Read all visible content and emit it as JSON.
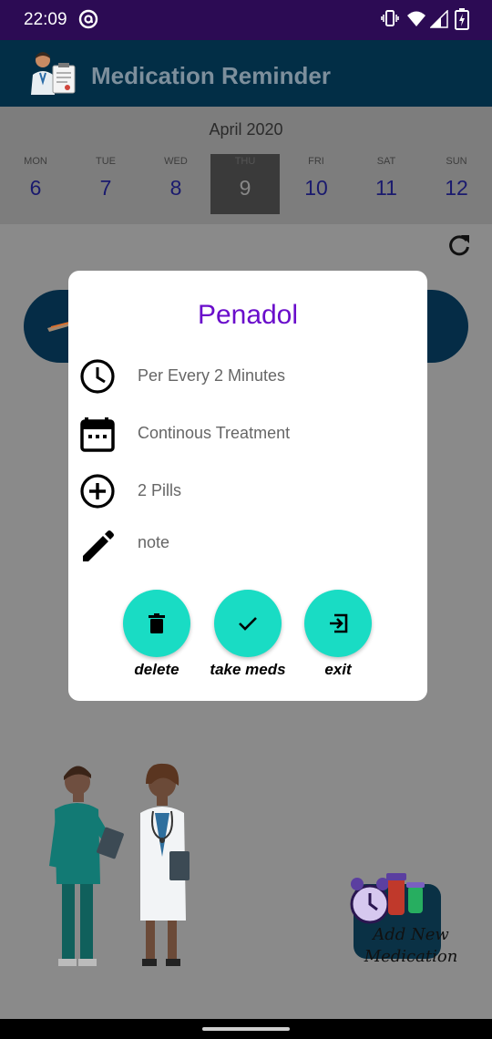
{
  "status": {
    "time": "22:09"
  },
  "app": {
    "title": "Medication Reminder"
  },
  "calendar": {
    "month": "April 2020",
    "days": [
      {
        "name": "MON",
        "num": "6"
      },
      {
        "name": "TUE",
        "num": "7"
      },
      {
        "name": "WED",
        "num": "8"
      },
      {
        "name": "THU",
        "num": "9"
      },
      {
        "name": "FRI",
        "num": "10"
      },
      {
        "name": "SAT",
        "num": "11"
      },
      {
        "name": "SUN",
        "num": "12"
      }
    ],
    "selected": "THU"
  },
  "dialog": {
    "title": "Penadol",
    "rows": [
      {
        "icon": "clock-icon",
        "text": "Per Every 2 Minutes"
      },
      {
        "icon": "calendar-icon",
        "text": "Continous Treatment"
      },
      {
        "icon": "plus-circle-icon",
        "text": "2 Pills"
      },
      {
        "icon": "pencil-icon",
        "text": "note"
      }
    ],
    "actions": [
      {
        "icon": "trash-icon",
        "label": "delete"
      },
      {
        "icon": "check-icon",
        "label": "take meds"
      },
      {
        "icon": "exit-icon",
        "label": "exit"
      }
    ]
  },
  "add_new": {
    "label": "Add New Medication"
  },
  "colors": {
    "accent": "#19dcc4",
    "title": "#6a0dcb",
    "appbar": "#022e46",
    "statusbar": "#2c0b54"
  }
}
